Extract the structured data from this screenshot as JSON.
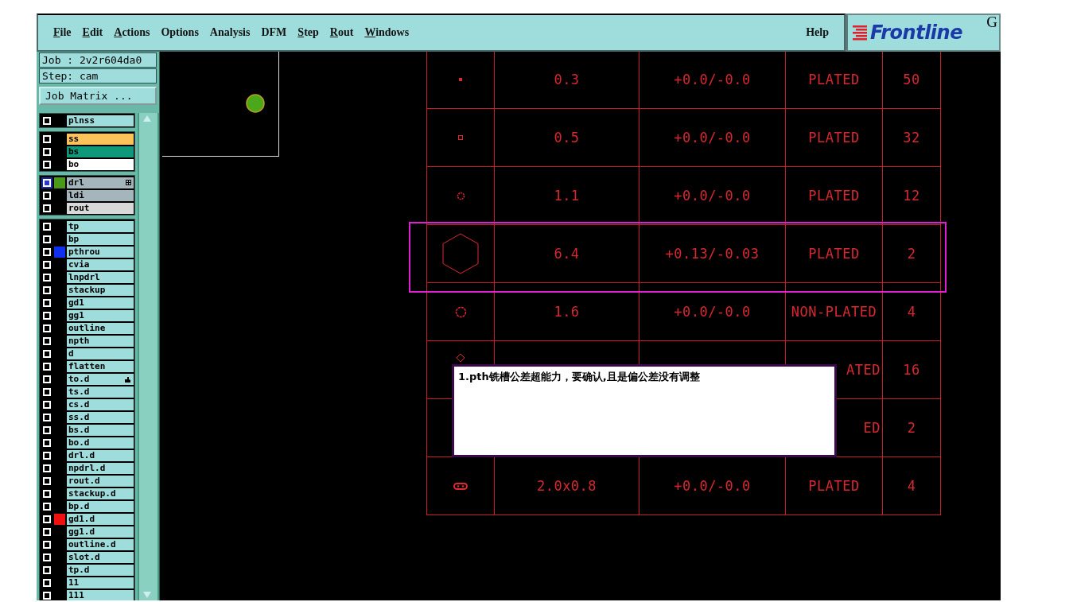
{
  "menu": [
    {
      "label": "File",
      "mnemonic": true
    },
    {
      "label": "Edit",
      "mnemonic": true
    },
    {
      "label": "Actions",
      "mnemonic": true
    },
    {
      "label": "Options",
      "mnemonic": false
    },
    {
      "label": "Analysis",
      "mnemonic": false
    },
    {
      "label": "DFM",
      "mnemonic": false
    },
    {
      "label": "Step",
      "mnemonic": true
    },
    {
      "label": "Rout",
      "mnemonic": true
    },
    {
      "label": "Windows",
      "mnemonic": true
    }
  ],
  "help": "Help",
  "logo": {
    "text": "Frontline",
    "badge": "G"
  },
  "job": "Job : 2v2r604da0",
  "step": "Step: cam",
  "job_matrix_button": "Job Matrix ...",
  "layer_groups": [
    [
      {
        "name": "plnss",
        "kind": "plain",
        "selected": false
      }
    ],
    [
      {
        "name": "ss",
        "kind": "mask",
        "selected": false
      },
      {
        "name": "bs",
        "kind": "bottom",
        "selected": false
      },
      {
        "name": "bo",
        "kind": "legend",
        "selected": false
      }
    ],
    [
      {
        "name": "drl",
        "kind": "drill-grid",
        "selected": true,
        "color": "#4a9a1a"
      },
      {
        "name": "ldi",
        "kind": "drill",
        "selected": false
      },
      {
        "name": "rout",
        "kind": "rout",
        "selected": false
      }
    ],
    [
      {
        "name": "tp",
        "kind": "plain",
        "selected": false
      },
      {
        "name": "bp",
        "kind": "plain",
        "selected": false
      },
      {
        "name": "pthrou",
        "kind": "plain",
        "selected": false,
        "color": "#1030f0"
      },
      {
        "name": "cvia",
        "kind": "plain",
        "selected": false
      },
      {
        "name": "lnpdrl",
        "kind": "plain",
        "selected": false
      },
      {
        "name": "stackup",
        "kind": "plain",
        "selected": false
      },
      {
        "name": "gd1",
        "kind": "plain",
        "selected": false
      },
      {
        "name": "gg1",
        "kind": "plain",
        "selected": false
      },
      {
        "name": "outline",
        "kind": "plain",
        "selected": false
      },
      {
        "name": "npth",
        "kind": "plain",
        "selected": false
      },
      {
        "name": "d",
        "kind": "plain",
        "selected": false
      },
      {
        "name": "flatten",
        "kind": "plain",
        "selected": false
      },
      {
        "name": "to.d",
        "kind": "plain-hand",
        "selected": false
      },
      {
        "name": "ts.d",
        "kind": "plain",
        "selected": false
      },
      {
        "name": "cs.d",
        "kind": "plain",
        "selected": false
      },
      {
        "name": "ss.d",
        "kind": "plain",
        "selected": false
      },
      {
        "name": "bs.d",
        "kind": "plain",
        "selected": false
      },
      {
        "name": "bo.d",
        "kind": "plain",
        "selected": false
      },
      {
        "name": "drl.d",
        "kind": "plain",
        "selected": false
      },
      {
        "name": "npdrl.d",
        "kind": "plain",
        "selected": false
      },
      {
        "name": "rout.d",
        "kind": "plain",
        "selected": false
      },
      {
        "name": "stackup.d",
        "kind": "plain",
        "selected": false
      },
      {
        "name": "bp.d",
        "kind": "plain",
        "selected": false
      },
      {
        "name": "gd1.d",
        "kind": "plain",
        "selected": false,
        "color": "#f01010"
      },
      {
        "name": "gg1.d",
        "kind": "plain",
        "selected": false
      },
      {
        "name": "outline.d",
        "kind": "plain",
        "selected": false
      },
      {
        "name": "slot.d",
        "kind": "plain",
        "selected": false
      },
      {
        "name": "tp.d",
        "kind": "plain",
        "selected": false
      },
      {
        "name": "11",
        "kind": "plain",
        "selected": false
      },
      {
        "name": "111",
        "kind": "plain",
        "selected": false
      }
    ]
  ],
  "drill_table": {
    "rows": [
      {
        "kind": "dot",
        "size": "0.3",
        "tolerance": "+0.0/-0.0",
        "finish": "PLATED",
        "count": "50"
      },
      {
        "kind": "square",
        "size": "0.5",
        "tolerance": "+0.0/-0.0",
        "finish": "PLATED",
        "count": "32"
      },
      {
        "kind": "gear",
        "size": "1.1",
        "tolerance": "+0.0/-0.0",
        "finish": "PLATED",
        "count": "12"
      },
      {
        "kind": "hexagon",
        "size": "6.4",
        "tolerance": "+0.13/-0.03",
        "finish": "PLATED",
        "count": "2",
        "selected": true
      },
      {
        "kind": "ring",
        "size": "1.6",
        "tolerance": "+0.0/-0.0",
        "finish": "NON-PLATED",
        "count": "4"
      },
      {
        "kind": "diamond",
        "finish": "ATED",
        "count": "16"
      },
      {
        "finish": "ED",
        "count": "2"
      },
      {
        "kind": "slot",
        "size": "2.0x0.8",
        "tolerance": "+0.0/-0.0",
        "finish": "PLATED",
        "count": "4"
      }
    ]
  },
  "note": "1.pth铣槽公差超能力，要确认,且是偏公差没有调整"
}
